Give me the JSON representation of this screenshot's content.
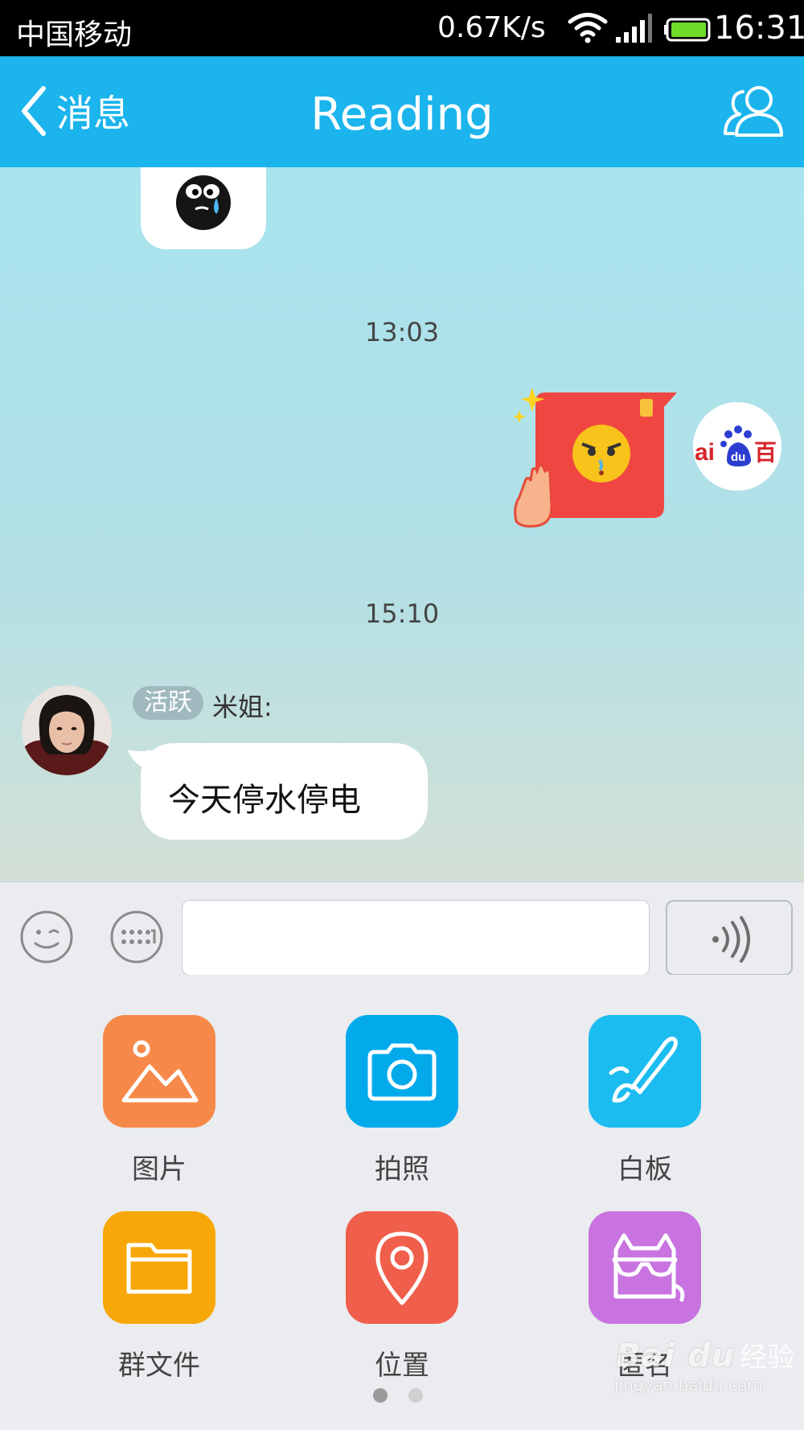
{
  "status_bar": {
    "carrier": "中国移动",
    "network_speed": "0.67K/s",
    "time": "16:31",
    "icons": [
      "wifi-icon",
      "signal-icon",
      "battery-icon"
    ]
  },
  "header": {
    "back_label": "消息",
    "title": "Reading",
    "right_icon": "group-members-icon",
    "background": "#1bb4ec"
  },
  "chat": {
    "messages": [
      {
        "type": "sticker",
        "side": "left",
        "sticker": "crying-black-ball-sticker"
      },
      {
        "type": "timestamp",
        "text": "13:03"
      },
      {
        "type": "sticker",
        "side": "right",
        "sticker": "angry-red-envelope-sticker",
        "avatar": "baidu-avatar"
      },
      {
        "type": "timestamp",
        "text": "15:10"
      },
      {
        "type": "text",
        "side": "left",
        "badge": "活跃",
        "sender": "米姐:",
        "text": "今天停水停电",
        "avatar": "user-photo-avatar"
      }
    ]
  },
  "input_bar": {
    "input_value": "",
    "icons": [
      "emoji-icon",
      "keyboard-icon",
      "voice-icon"
    ]
  },
  "panel": {
    "items": [
      {
        "label": "图片",
        "icon": "image-icon",
        "color": "#f6894a"
      },
      {
        "label": "拍照",
        "icon": "camera-icon",
        "color": "#02aaec"
      },
      {
        "label": "白板",
        "icon": "whiteboard-brush-icon",
        "color": "#1bbcf0"
      },
      {
        "label": "群文件",
        "icon": "folder-icon",
        "color": "#f7a707"
      },
      {
        "label": "位置",
        "icon": "location-pin-icon",
        "color": "#f05f4c"
      },
      {
        "label": "匿名",
        "icon": "anonymous-mask-icon",
        "color": "#c873e0"
      }
    ],
    "page_indicator": {
      "current": 1,
      "total": 2
    }
  },
  "watermark": {
    "logo_text": "Bai du",
    "cn_text": "经验",
    "url": "jingyan.baidu.com"
  }
}
